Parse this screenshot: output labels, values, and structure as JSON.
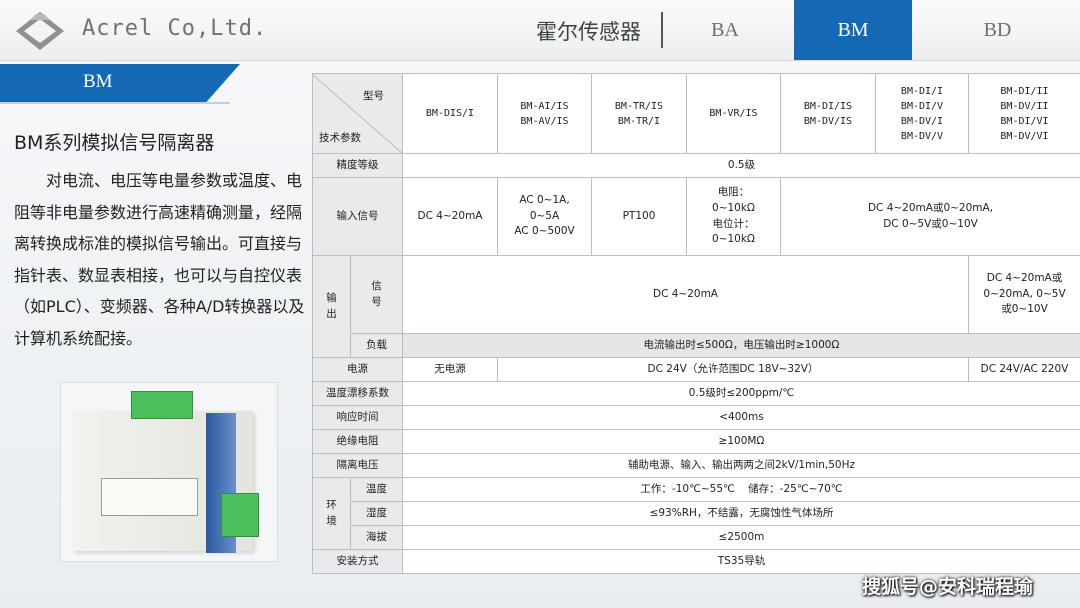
{
  "header": {
    "company": "Acrel Co,Ltd.",
    "section": "霍尔传感器",
    "tabs": [
      {
        "label": "BA",
        "active": false
      },
      {
        "label": "BM",
        "active": true
      },
      {
        "label": "BD",
        "active": false
      }
    ],
    "accent_color": "#1568b3"
  },
  "left": {
    "banner": "BM",
    "title": "BM系列模拟信号隔离器",
    "description": "对电流、电压等电量参数或温度、电阻等非电量参数进行高速精确测量，经隔离转换成标准的模拟信号输出。可直接与指针表、数显表相接，也可以与自控仪表（如PLC）、变频器、各种A/D转换器以及计算机系统配接。"
  },
  "table": {
    "corner_top": "型号",
    "corner_bottom": "技术参数",
    "models": [
      [
        "BM-DIS/I"
      ],
      [
        "BM-AI/IS",
        "BM-AV/IS"
      ],
      [
        "BM-TR/IS",
        "BM-TR/I"
      ],
      [
        "BM-VR/IS"
      ],
      [
        "BM-DI/IS",
        "BM-DV/IS"
      ],
      [
        "BM-DI/I",
        "BM-DI/V",
        "BM-DV/I",
        "BM-DV/V"
      ],
      [
        "BM-DI/II",
        "BM-DV/II",
        "BM-DI/VI",
        "BM-DV/VI"
      ]
    ],
    "accuracy": {
      "label": "精度等级",
      "value": "0.5级"
    },
    "input": {
      "label": "输入信号",
      "c1": "DC 4~20mA",
      "c2": [
        "AC 0~1A,",
        "0~5A",
        "AC 0~500V"
      ],
      "c3": "PT100",
      "c4": [
        "电阻：",
        "0~10kΩ",
        "电位计：",
        "0~10kΩ"
      ],
      "c5": [
        "DC 4~20mA或0~20mA,",
        "DC 0~5V或0~10V"
      ]
    },
    "output": {
      "label": [
        "输",
        "出"
      ],
      "signal_label": [
        "信",
        "号"
      ],
      "signal_main": "DC 4~20mA",
      "signal_alt": [
        "DC 4~20mA或",
        "0~20mA, 0~5V",
        "或0~10V"
      ],
      "load_label": "负载",
      "load_value": "电流输出时≤500Ω，电压输出时≥1000Ω"
    },
    "power": {
      "label": "电源",
      "c1": "无电源",
      "c2": "DC 24V（允许范围DC 18V~32V）",
      "c3": "DC 24V/AC 220V"
    },
    "temp_drift": {
      "label": "温度漂移系数",
      "value": "0.5级时≤200ppm/℃"
    },
    "response": {
      "label": "响应时间",
      "value": "<400ms"
    },
    "insulation": {
      "label": "绝缘电阻",
      "value": "≥100MΩ"
    },
    "isolation": {
      "label": "隔离电压",
      "value": "辅助电源、输入、输出两两之间2kV/1min,50Hz"
    },
    "environment": {
      "label": [
        "环",
        "境"
      ],
      "temp_label": "温度",
      "temp_value": "工作：-10℃~55℃    储存：-25℃~70℃",
      "humid_label": "湿度",
      "humid_value": "≤93%RH，不结露，无腐蚀性气体场所",
      "alt_label": "海拔",
      "alt_value": "≤2500m"
    },
    "install": {
      "label": "安装方式",
      "value": "TS35导轨"
    }
  },
  "watermark": "搜狐号@安科瑞程瑜"
}
